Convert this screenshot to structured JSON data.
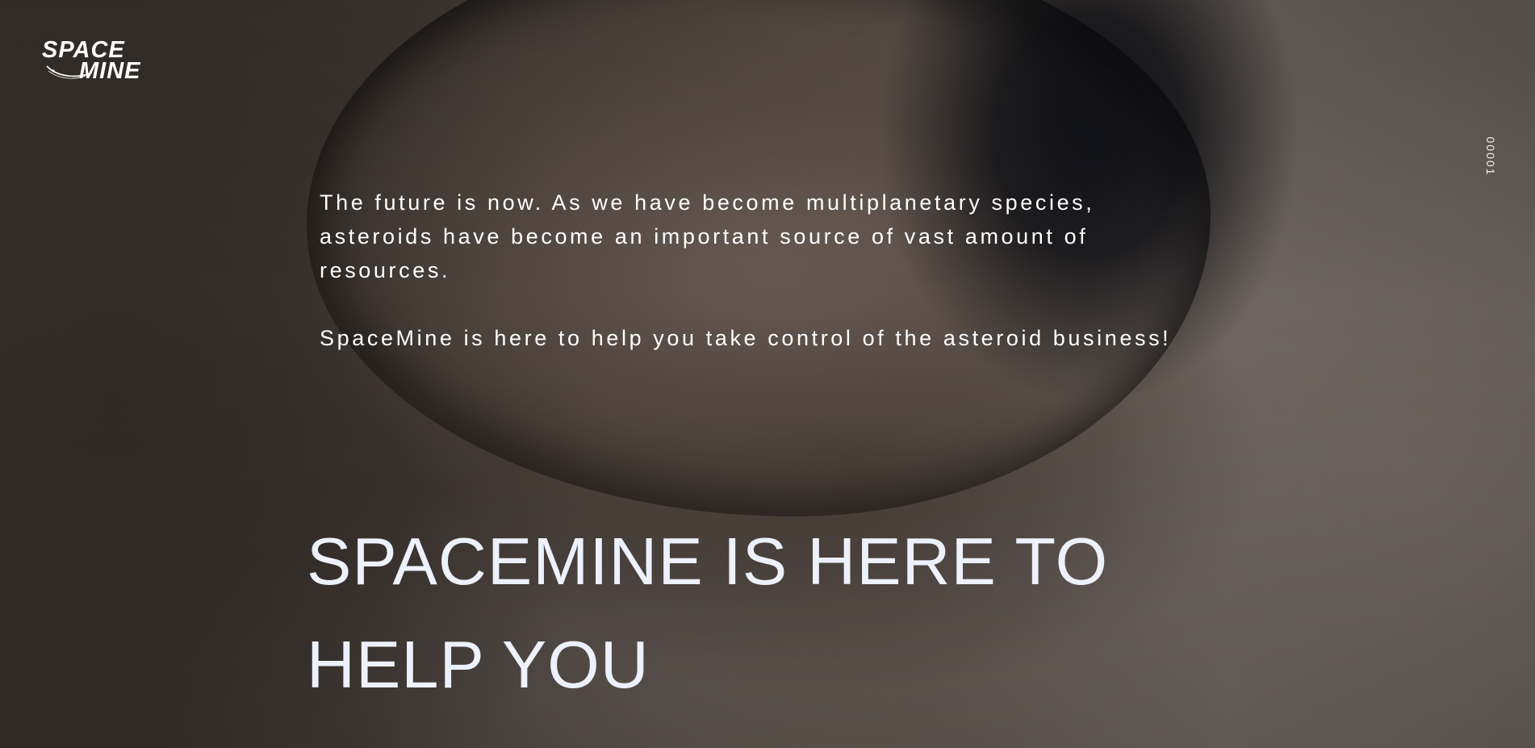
{
  "brand": {
    "logo_top": "SPACE",
    "logo_bottom": "MINE"
  },
  "side_counter": "00001",
  "intro": {
    "paragraph_1": "The future is now. As we have become multiplanetary species, asteroids have become an important source of vast amount of resources.",
    "paragraph_2": "SpaceMine is here to help you take control of the asteroid business!"
  },
  "hero": {
    "headline": "SPACEMINE IS HERE TO HELP YOU"
  },
  "colors": {
    "text": "#ffffff",
    "headline": "#ecf1fb",
    "background": "#3a342f"
  }
}
